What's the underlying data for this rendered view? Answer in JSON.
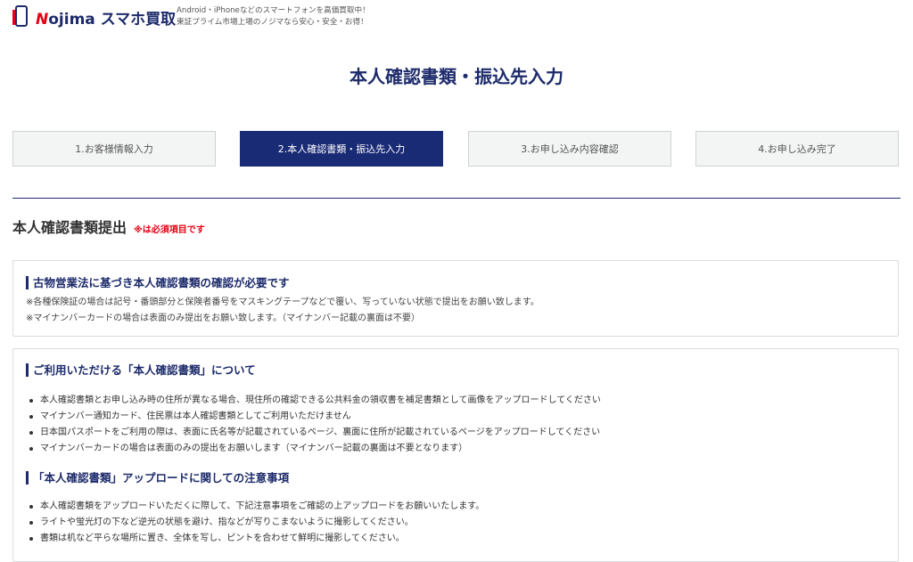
{
  "header": {
    "logo_n": "N",
    "logo_text": "ojima スマホ買取",
    "tagline_line1": "Android・iPhoneなどのスマートフォンを高価買取中！",
    "tagline_line2": "東証プライム市場上場のノジマなら安心・安全・お得！"
  },
  "page_title": "本人確認書類・振込先入力",
  "steps": [
    {
      "label": "1.お客様情報入力",
      "active": false
    },
    {
      "label": "2.本人確認書類・振込先入力",
      "active": true
    },
    {
      "label": "3.お申し込み内容確認",
      "active": false
    },
    {
      "label": "4.お申し込み完了",
      "active": false
    }
  ],
  "section": {
    "title": "本人確認書類提出",
    "required_note": "※は必須項目です"
  },
  "notice_box": {
    "heading": "古物営業法に基づき本人確認書類の確認が必要です",
    "notes": [
      "※各種保険証の場合は記号・番頭部分と保険者番号をマスキングテープなどで覆い、写っていない状態で提出をお願い致します。",
      "※マイナンバーカードの場合は表面のみ提出をお願い致します。（マイナンバー記載の裏面は不要）"
    ]
  },
  "info_box": {
    "heading1": "ご利用いただける「本人確認書類」について",
    "list1": [
      "本人確認書類とお申し込み時の住所が異なる場合、現住所の確認できる公共料金の領収書を補足書類として画像をアップロードしてください",
      "マイナンバー通知カード、住民票は本人確認書類としてご利用いただけません",
      "日本国パスポートをご利用の際は、表面に氏名等が記載されているページ、裏面に住所が記載されているページをアップロードしてください",
      "マイナンバーカードの場合は表面のみの提出をお願いします（マイナンバー記載の裏面は不要となります）"
    ],
    "heading2": "「本人確認書類」アップロードに関しての注意事項",
    "list2": [
      "本人確認書類をアップロードいただくに際して、下記注意事項をご確認の上アップロードをお願いいたします。",
      "ライトや蛍光灯の下など逆光の状態を避け、指などが写りこまないように撮影してください。",
      "書類は机など平らな場所に置き、全体を写し、ピントを合わせて鮮明に撮影してください。"
    ]
  },
  "colors": {
    "brand_navy": "#1d2b6b",
    "active_step": "#1a2b76",
    "required_red": "#e60012"
  }
}
